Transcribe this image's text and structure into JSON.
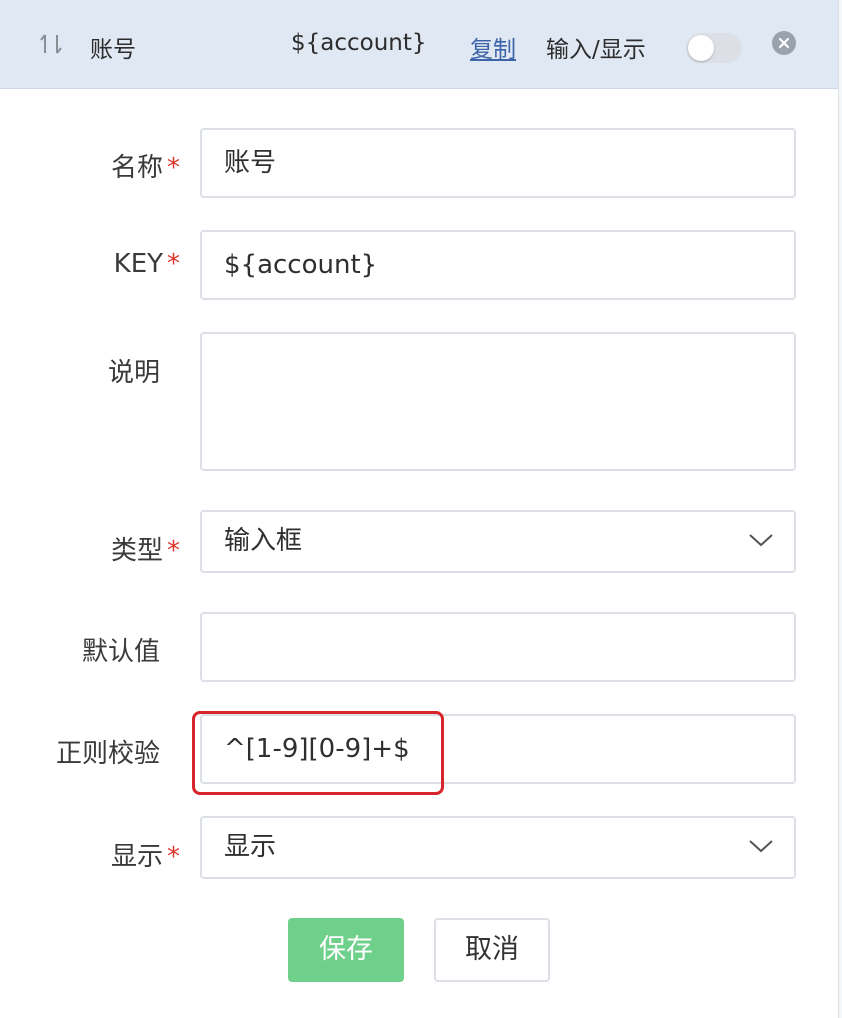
{
  "header": {
    "title": "账号",
    "key": "${account}",
    "copy_label": "复制",
    "mode_label": "输入/显示",
    "toggle_on": false
  },
  "form": {
    "name": {
      "label": "名称",
      "required": "*",
      "value": "账号"
    },
    "key": {
      "label": "KEY",
      "required": "*",
      "value": "${account}"
    },
    "description": {
      "label": "说明",
      "value": ""
    },
    "type": {
      "label": "类型",
      "required": "*",
      "value": "输入框"
    },
    "default": {
      "label": "默认值",
      "value": ""
    },
    "regex": {
      "label": "正则校验",
      "value": "^[1-9][0-9]+$"
    },
    "display": {
      "label": "显示",
      "required": "*",
      "value": "显示"
    }
  },
  "buttons": {
    "save": "保存",
    "cancel": "取消"
  },
  "colors": {
    "header_bg": "#dfe8f3",
    "link": "#3d64a8",
    "required": "#e0342a",
    "save_bg": "#6fd08c",
    "highlight": "#d7252b"
  }
}
